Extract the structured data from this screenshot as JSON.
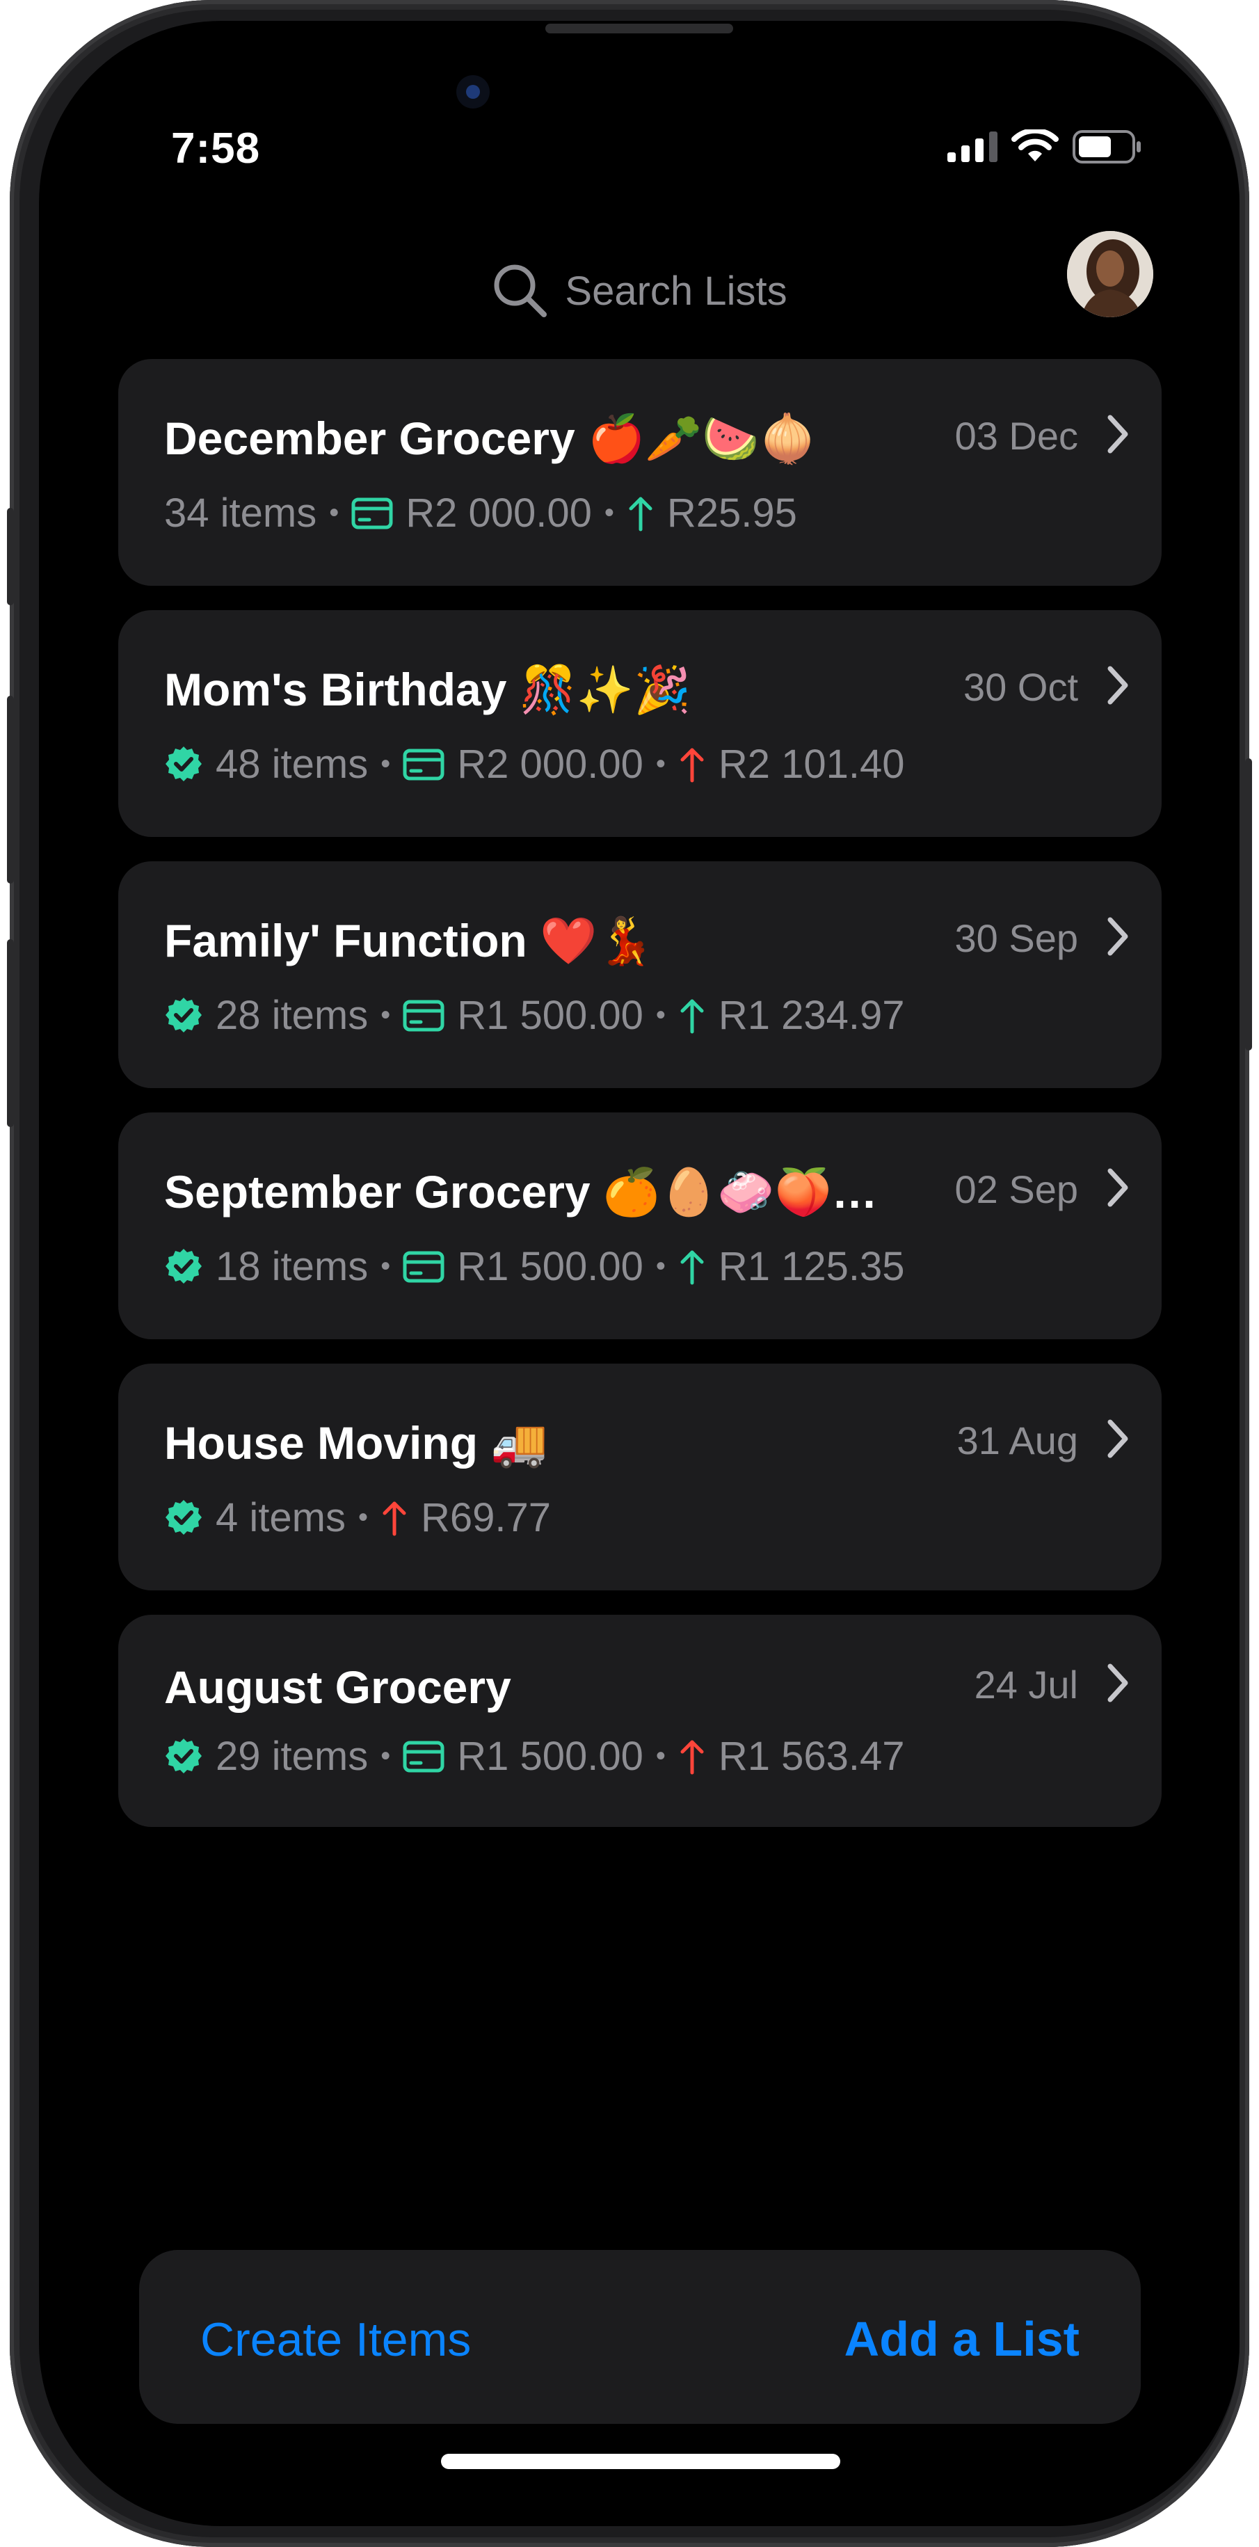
{
  "status_bar": {
    "time": "7:58"
  },
  "header": {
    "search_placeholder": "Search Lists"
  },
  "lists": [
    {
      "title": "December Grocery 🍎🥕🍉🧅",
      "date": "03 Dec",
      "verified": false,
      "items": "34 items",
      "budget": "R2 000.00",
      "trend": "up",
      "trend_color": "#30d5a5",
      "amount": "R25.95"
    },
    {
      "title": "Mom's Birthday 🎊✨🎉",
      "date": "30 Oct",
      "verified": true,
      "items": "48 items",
      "budget": "R2 000.00",
      "trend": "up",
      "trend_color": "#ff453a",
      "amount": "R2 101.40"
    },
    {
      "title": "Family' Function ❤️💃",
      "date": "30 Sep",
      "verified": true,
      "items": "28 items",
      "budget": "R1 500.00",
      "trend": "up",
      "trend_color": "#30d5a5",
      "amount": "R1 234.97"
    },
    {
      "title": "September Grocery 🍊🥚🧼🍑🥬…",
      "date": "02 Sep",
      "verified": true,
      "items": "18 items",
      "budget": "R1 500.00",
      "trend": "up",
      "trend_color": "#30d5a5",
      "amount": "R1 125.35"
    },
    {
      "title": "House Moving 🚚",
      "date": "31 Aug",
      "verified": true,
      "items": "4 items",
      "budget": null,
      "trend": "up",
      "trend_color": "#ff453a",
      "amount": "R69.77"
    },
    {
      "title": "August Grocery",
      "date": "24 Jul",
      "verified": true,
      "items": "29 items",
      "budget": "R1 500.00",
      "trend": "up",
      "trend_color": "#ff453a",
      "amount": "R1 563.47"
    }
  ],
  "bottom_bar": {
    "create_label": "Create Items",
    "add_label": "Add a List"
  },
  "colors": {
    "accent": "#0a84ff",
    "verified": "#30d5a5",
    "up_green": "#30d5a5",
    "up_red": "#ff453a",
    "card": "#1c1c1e"
  }
}
